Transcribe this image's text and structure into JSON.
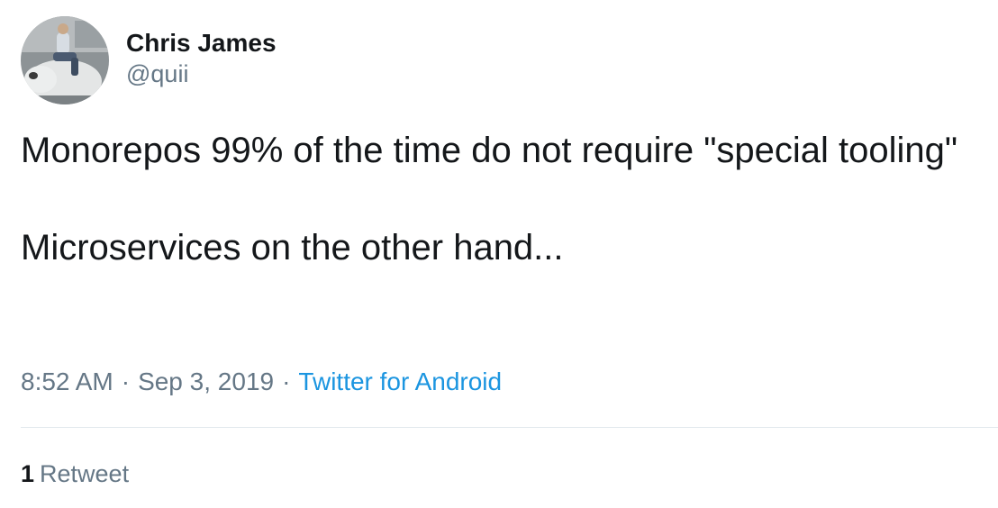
{
  "tweet": {
    "display_name": "Chris James",
    "handle": "@quii",
    "text_lines": [
      "Monorepos 99% of the time do not require \"special tooling\"",
      "Microservices on the other hand..."
    ],
    "time": "8:52 AM",
    "date": "Sep 3, 2019",
    "separator": "·",
    "source": "Twitter for Android",
    "retweet_count": "1",
    "retweet_label": "Retweet"
  },
  "colors": {
    "text": "#14171a",
    "secondary": "#657786",
    "link": "#1b95e0",
    "divider": "#e1e8ed"
  }
}
